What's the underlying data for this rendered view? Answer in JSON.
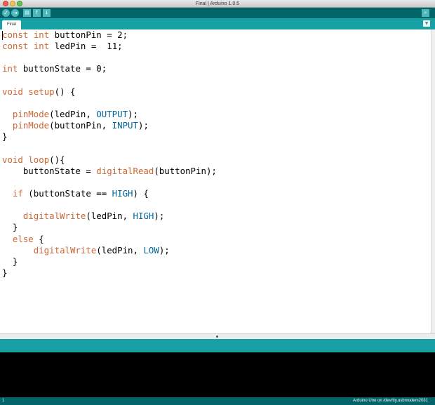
{
  "window": {
    "title": "Final | Arduino 1.0.5"
  },
  "toolbar": {
    "verify_icon": "check-icon",
    "upload_icon": "arrow-right-icon",
    "new_icon": "new-file-icon",
    "open_icon": "arrow-up-icon",
    "save_icon": "arrow-down-icon",
    "serial_icon": "magnifier-icon"
  },
  "tabs": [
    {
      "label": "Final"
    }
  ],
  "code": {
    "lines": [
      [
        {
          "t": "const",
          "c": "kw"
        },
        {
          "t": " "
        },
        {
          "t": "int",
          "c": "kw"
        },
        {
          "t": " buttonPin = 2;"
        }
      ],
      [
        {
          "t": "const",
          "c": "kw"
        },
        {
          "t": " "
        },
        {
          "t": "int",
          "c": "kw"
        },
        {
          "t": " ledPin =  11;"
        }
      ],
      [],
      [
        {
          "t": "int",
          "c": "kw"
        },
        {
          "t": " buttonState = 0;"
        }
      ],
      [],
      [
        {
          "t": "void",
          "c": "kw"
        },
        {
          "t": " "
        },
        {
          "t": "setup",
          "c": "fn"
        },
        {
          "t": "() {"
        }
      ],
      [],
      [
        {
          "t": "  "
        },
        {
          "t": "pinMode",
          "c": "fn"
        },
        {
          "t": "(ledPin, "
        },
        {
          "t": "OUTPUT",
          "c": "cst"
        },
        {
          "t": ");"
        }
      ],
      [
        {
          "t": "  "
        },
        {
          "t": "pinMode",
          "c": "fn"
        },
        {
          "t": "(buttonPin, "
        },
        {
          "t": "INPUT",
          "c": "cst"
        },
        {
          "t": ");"
        }
      ],
      [
        {
          "t": "}"
        }
      ],
      [],
      [
        {
          "t": "void",
          "c": "kw"
        },
        {
          "t": " "
        },
        {
          "t": "loop",
          "c": "fn"
        },
        {
          "t": "(){"
        }
      ],
      [
        {
          "t": "    buttonState = "
        },
        {
          "t": "digitalRead",
          "c": "fn"
        },
        {
          "t": "(buttonPin);"
        }
      ],
      [],
      [
        {
          "t": "  "
        },
        {
          "t": "if",
          "c": "kw"
        },
        {
          "t": " (buttonState == "
        },
        {
          "t": "HIGH",
          "c": "cst"
        },
        {
          "t": ") {"
        }
      ],
      [],
      [
        {
          "t": "    "
        },
        {
          "t": "digitalWrite",
          "c": "fn"
        },
        {
          "t": "(ledPin, "
        },
        {
          "t": "HIGH",
          "c": "cst"
        },
        {
          "t": ");"
        }
      ],
      [
        {
          "t": "  }"
        }
      ],
      [
        {
          "t": "  "
        },
        {
          "t": "else",
          "c": "kw"
        },
        {
          "t": " {"
        }
      ],
      [
        {
          "t": "      "
        },
        {
          "t": "digitalWrite",
          "c": "fn"
        },
        {
          "t": "(ledPin, "
        },
        {
          "t": "LOW",
          "c": "cst"
        },
        {
          "t": ");"
        }
      ],
      [
        {
          "t": "  }"
        }
      ],
      [
        {
          "t": "}"
        }
      ]
    ]
  },
  "status": {
    "line_number": "1",
    "board": "Arduino Uno on /dev/tty.usbmodem2031"
  },
  "colors": {
    "toolbar": "#006468",
    "tabbar": "#17a1a5",
    "keyword": "#cc6633",
    "constant": "#006699"
  }
}
